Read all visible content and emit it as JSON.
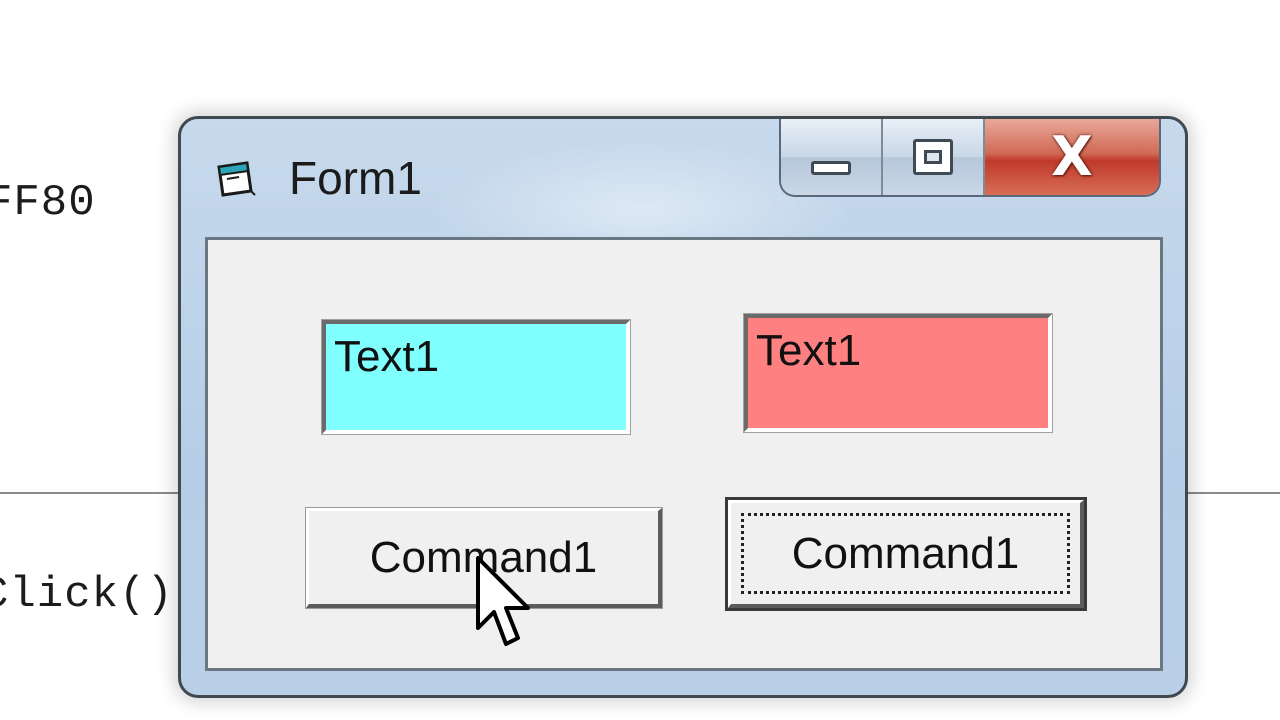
{
  "background_code": {
    "line1": "FF80",
    "line2": "Click()"
  },
  "window": {
    "title": "Form1",
    "icon": "form-window-icon",
    "caption_buttons": {
      "minimize": "minimize-icon",
      "maximize": "maximize-icon",
      "close": "close-icon"
    }
  },
  "textboxes": [
    {
      "value": "Text1",
      "bg_color": "#80ffff"
    },
    {
      "value": "Text1",
      "bg_color": "#ff8080"
    }
  ],
  "buttons": [
    {
      "label": "Command1"
    },
    {
      "label": "Command1"
    }
  ],
  "cursor": "arrow-cursor-icon"
}
